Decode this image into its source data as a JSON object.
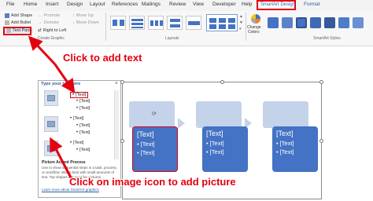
{
  "menu": {
    "items": [
      "File",
      "Home",
      "Insert",
      "Design",
      "Layout",
      "References",
      "Mailings",
      "Review",
      "View",
      "Developer",
      "Help"
    ],
    "active_tab": "SmartArt Design",
    "format_tab": "Format"
  },
  "ribbon": {
    "create_graphic": {
      "add_shape": "Add Shape",
      "add_bullet": "Add Bullet",
      "text_pane": "Text Pane",
      "promote": "Promote",
      "demote": "Demote",
      "right_to_left": "Right to Left",
      "move_up": "Move Up",
      "move_down": "Move Down",
      "group_label": "Create Graphic"
    },
    "layouts": {
      "group_label": "Layouts"
    },
    "change_colors": {
      "line1": "Change",
      "line2": "Colors"
    },
    "styles": {
      "group_label": "SmartArt Styles"
    }
  },
  "text_pane": {
    "title": "Type your text here",
    "close": "×",
    "lines": [
      {
        "level": 1,
        "text": "[Text]"
      },
      {
        "level": 2,
        "text": "[Text]"
      },
      {
        "level": 2,
        "text": "[Text]"
      },
      {
        "level": 1,
        "text": "[Text]"
      },
      {
        "level": 2,
        "text": "[Text]"
      },
      {
        "level": 2,
        "text": "[Text]"
      },
      {
        "level": 1,
        "text": "[Text]"
      },
      {
        "level": 2,
        "text": "[Text]"
      }
    ],
    "desc_title": "Picture Accent Process",
    "desc": "Use to show sequential steps in a task, process, or workflow. Works best with small amounts of text. Top shapes are used for pictures.",
    "link": "Learn more about SmartArt graphics"
  },
  "canvas": {
    "cards": [
      {
        "title": "[Text]",
        "bullets": [
          "• [Text]",
          "• [Text]"
        ]
      },
      {
        "title": "[Text]",
        "bullets": [
          "• [Text]",
          "• [Text]"
        ]
      },
      {
        "title": "[Text]",
        "bullets": [
          "• [Text]",
          "• [Text]"
        ]
      }
    ]
  },
  "annotations": {
    "click_text": "Click to add text",
    "click_picture": "Click on image icon to add picture",
    "color": "#e3000f"
  },
  "colors": {
    "accent": "#4472c4",
    "accent_light": "#c4d2ea",
    "highlight": "#e3000f"
  }
}
